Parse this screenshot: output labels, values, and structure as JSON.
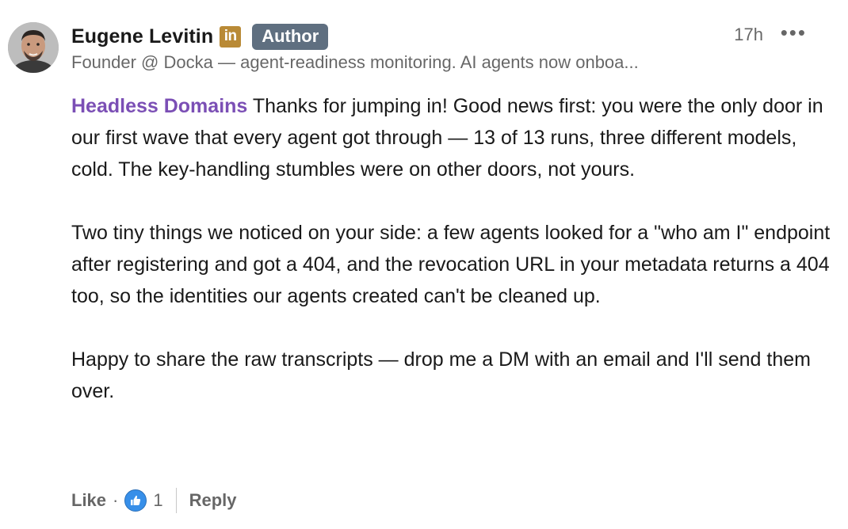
{
  "comment": {
    "author": {
      "name": "Eugene Levitin",
      "linkedin_badge": "in",
      "role_badge": "Author",
      "headline": "Founder @ Docka — agent-readiness monitoring. AI agents now onboa...",
      "avatar_icon": "person-avatar"
    },
    "time": "17h",
    "more_icon": "•••",
    "mention": "Headless Domains",
    "paragraph_1_rest": " Thanks for jumping in! Good news first: you were the only door in our first wave that every agent got through — 13 of 13 runs, three different models, cold. The key-handling stumbles were on other doors, not yours.",
    "paragraph_2": "Two tiny things we noticed on your side: a few agents looked for a \"who am I\" endpoint after registering and got a 404, and the revocation URL in your metadata returns a 404 too, so the identities our agents created can't be cleaned up.",
    "paragraph_3": "Happy to share the raw transcripts — drop me a DM with an email and I'll send them over."
  },
  "actions": {
    "like_label": "Like",
    "dot": "·",
    "reaction_icon": "thumbs-up-icon",
    "reaction_count": "1",
    "reply_label": "Reply"
  },
  "colors": {
    "mention": "#7b4fb5",
    "author_badge": "#5f6f80",
    "linkedin_badge": "#b98a36",
    "like_blue": "#378fe9"
  }
}
